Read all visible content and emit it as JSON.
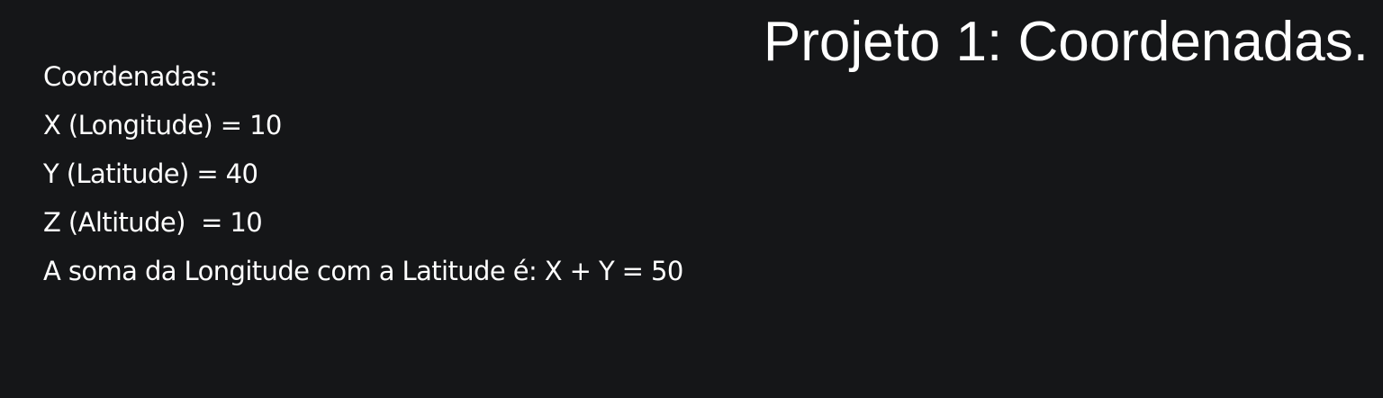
{
  "title": "Projeto 1: Coordenadas.",
  "lines": [
    "Coordenadas:",
    "X (Longitude) = 10",
    "Y (Latitude) = 40",
    "Z (Altitude)  = 10",
    "A soma da Longitude com a Latitude é: X + Y = 50"
  ],
  "colors": {
    "background": "#151618",
    "text": "#ffffff"
  }
}
